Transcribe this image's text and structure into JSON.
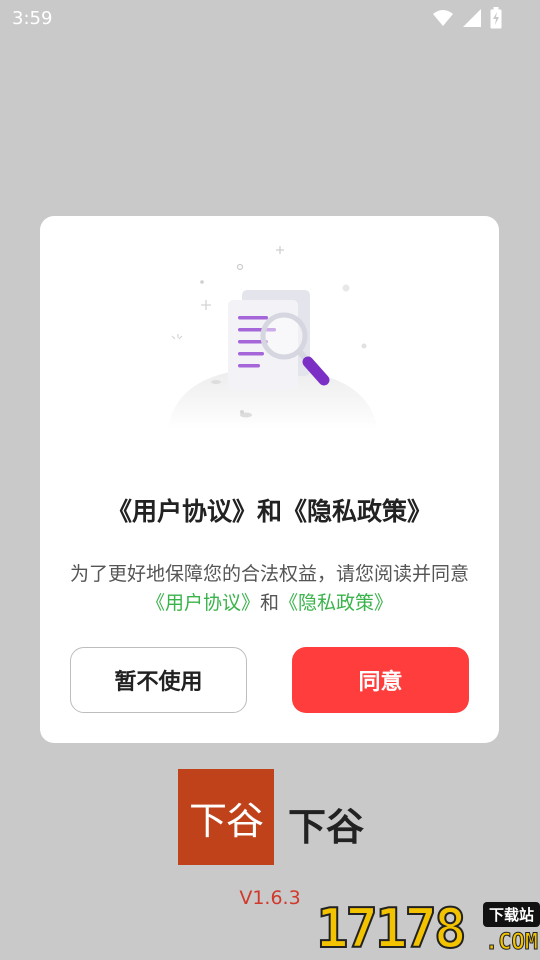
{
  "status_bar": {
    "time": "3:59",
    "icons": [
      "wifi-icon",
      "cell-signal-icon",
      "battery-charging-icon"
    ]
  },
  "dialog": {
    "title": "《用户协议》和《隐私政策》",
    "body_prefix": "为了更好地保障您的合法权益，请您阅读并同意",
    "user_agreement_link": "《用户协议》",
    "conjunction": "和",
    "privacy_policy_link": "《隐私政策》",
    "decline_label": "暂不使用",
    "agree_label": "同意"
  },
  "app": {
    "logo_text": "下谷",
    "name": "下谷",
    "version": "V1.6.3"
  },
  "watermark": {
    "number": "17178",
    "tag": "下载站",
    "domain": ".COM"
  },
  "colors": {
    "background": "#c9c9c9",
    "agree_button": "#ff3d3d",
    "link": "#39b34a",
    "logo": "#c0421a",
    "version": "#d0392b"
  }
}
